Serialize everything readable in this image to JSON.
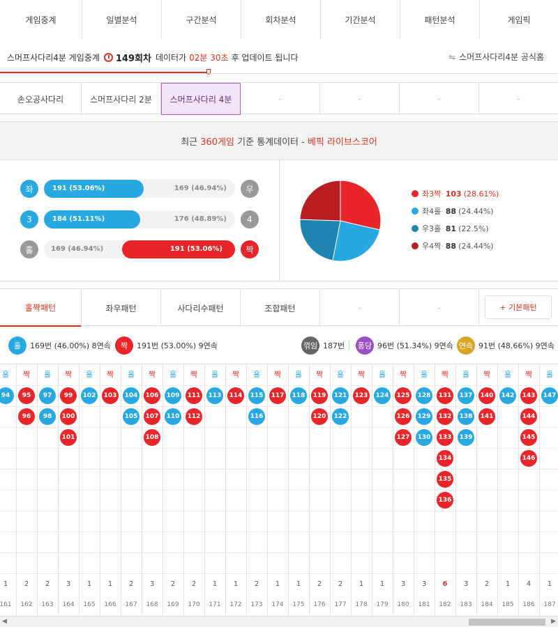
{
  "nav": {
    "tabs": [
      "게임중계",
      "일별분석",
      "구간분석",
      "회차분석",
      "기간분석",
      "패턴분석",
      "게임픽"
    ],
    "active": 0
  },
  "info": {
    "prefix": "스머프사다리4분 게임중계",
    "round": "149회차",
    "mid": "데이터가",
    "time": "02분 30초",
    "suffix": "후 업데이트 됩니다",
    "official": "스머프사다리4분 공식홈"
  },
  "games": {
    "tabs": [
      "손오공사다리",
      "스머프사다리 2분",
      "스머프사다리 4분",
      "-",
      "-",
      "-",
      "-"
    ],
    "active": 2
  },
  "stats": {
    "title_pre": "최근",
    "title_count": "360게임",
    "title_mid": "기준 통계데이터 -",
    "title_brand": "베픽 라이브스코어",
    "rows": [
      {
        "left_label": "좌",
        "left_text": "191 (53.06%)",
        "left_pct": 53.06,
        "right_text": "169 (46.94%)",
        "right_label": "우",
        "winner": "left"
      },
      {
        "left_label": "3",
        "left_text": "184 (51.11%)",
        "left_pct": 51.11,
        "right_text": "176 (48.89%)",
        "right_label": "4",
        "winner": "left"
      },
      {
        "left_label": "홀",
        "left_text": "169 (46.94%)",
        "left_pct": 46.94,
        "right_text": "191 (53.06%)",
        "right_label": "짝",
        "winner": "right"
      }
    ],
    "pie": [
      {
        "label": "좌3짝",
        "value": 103,
        "pct": "(28.61%)",
        "color": "#e8262a"
      },
      {
        "label": "좌4홀",
        "value": 88,
        "pct": "(24.44%)",
        "color": "#27a8e0"
      },
      {
        "label": "우3홀",
        "value": 81,
        "pct": "(22.5%)",
        "color": "#1e85b0"
      },
      {
        "label": "우4짝",
        "value": 88,
        "pct": "(24.44%)",
        "color": "#b81d22"
      }
    ]
  },
  "patterns": {
    "tabs": [
      "홀짝패턴",
      "좌우패턴",
      "사다리수패턴",
      "조합패턴",
      "-",
      "-"
    ],
    "active": 0,
    "basic_btn": "+ 기본패턴"
  },
  "summary": {
    "odd": {
      "label": "홀",
      "text": "169번 (46.00%) 8연속"
    },
    "even": {
      "label": "짝",
      "text": "191번 (53.00%) 9연속"
    },
    "flip": {
      "label": "꺾임",
      "text": "187번"
    },
    "pong": {
      "label": "퐁당",
      "text": "96번 (51.34%) 9연속"
    },
    "cont": {
      "label": "연속",
      "text": "91번 (48.66%) 9연속"
    }
  },
  "grid": {
    "columns": [
      {
        "type": "홀",
        "balls": [
          94
        ],
        "count": "1",
        "round": "161"
      },
      {
        "type": "짝",
        "balls": [
          95,
          96
        ],
        "count": "2",
        "round": "162"
      },
      {
        "type": "홀",
        "balls": [
          97,
          98
        ],
        "count": "2",
        "round": "163"
      },
      {
        "type": "짝",
        "balls": [
          99,
          100,
          101
        ],
        "count": "3",
        "round": "164"
      },
      {
        "type": "홀",
        "balls": [
          102
        ],
        "count": "1",
        "round": "165"
      },
      {
        "type": "짝",
        "balls": [
          103
        ],
        "count": "1",
        "round": "166"
      },
      {
        "type": "홀",
        "balls": [
          104,
          105
        ],
        "count": "2",
        "round": "167"
      },
      {
        "type": "짝",
        "balls": [
          106,
          107,
          108
        ],
        "count": "3",
        "round": "168"
      },
      {
        "type": "홀",
        "balls": [
          109,
          110
        ],
        "count": "2",
        "round": "169"
      },
      {
        "type": "짝",
        "balls": [
          111,
          112
        ],
        "count": "2",
        "round": "170"
      },
      {
        "type": "홀",
        "balls": [
          113
        ],
        "count": "1",
        "round": "171"
      },
      {
        "type": "짝",
        "balls": [
          114
        ],
        "count": "1",
        "round": "172"
      },
      {
        "type": "홀",
        "balls": [
          115,
          116
        ],
        "count": "2",
        "round": "173"
      },
      {
        "type": "짝",
        "balls": [
          117
        ],
        "count": "1",
        "round": "174"
      },
      {
        "type": "홀",
        "balls": [
          118
        ],
        "count": "1",
        "round": "175"
      },
      {
        "type": "짝",
        "balls": [
          119,
          120
        ],
        "count": "2",
        "round": "176"
      },
      {
        "type": "홀",
        "balls": [
          121,
          122
        ],
        "count": "2",
        "round": "177"
      },
      {
        "type": "짝",
        "balls": [
          123
        ],
        "count": "1",
        "round": "178"
      },
      {
        "type": "홀",
        "balls": [
          124
        ],
        "count": "1",
        "round": "179"
      },
      {
        "type": "짝",
        "balls": [
          125,
          126,
          127
        ],
        "count": "3",
        "round": "180"
      },
      {
        "type": "홀",
        "balls": [
          128,
          129,
          130
        ],
        "count": "3",
        "round": "181"
      },
      {
        "type": "짝",
        "balls": [
          131,
          132,
          133,
          134,
          135,
          136
        ],
        "count": "6",
        "round": "182",
        "highlight": true
      },
      {
        "type": "홀",
        "balls": [
          137,
          138,
          139
        ],
        "count": "3",
        "round": "183"
      },
      {
        "type": "짝",
        "balls": [
          140,
          141
        ],
        "count": "2",
        "round": "184"
      },
      {
        "type": "홀",
        "balls": [
          142
        ],
        "count": "1",
        "round": "185"
      },
      {
        "type": "짝",
        "balls": [
          143,
          144,
          145,
          146
        ],
        "count": "4",
        "round": "186"
      },
      {
        "type": "홀",
        "balls": [
          147
        ],
        "count": "1",
        "round": "187"
      }
    ]
  },
  "colors": {
    "blue": "#27a8e0",
    "red": "#e8262a",
    "gray": "#999999",
    "purple": "#9b4fc4",
    "gold": "#d6a624",
    "dark": "#666666"
  }
}
